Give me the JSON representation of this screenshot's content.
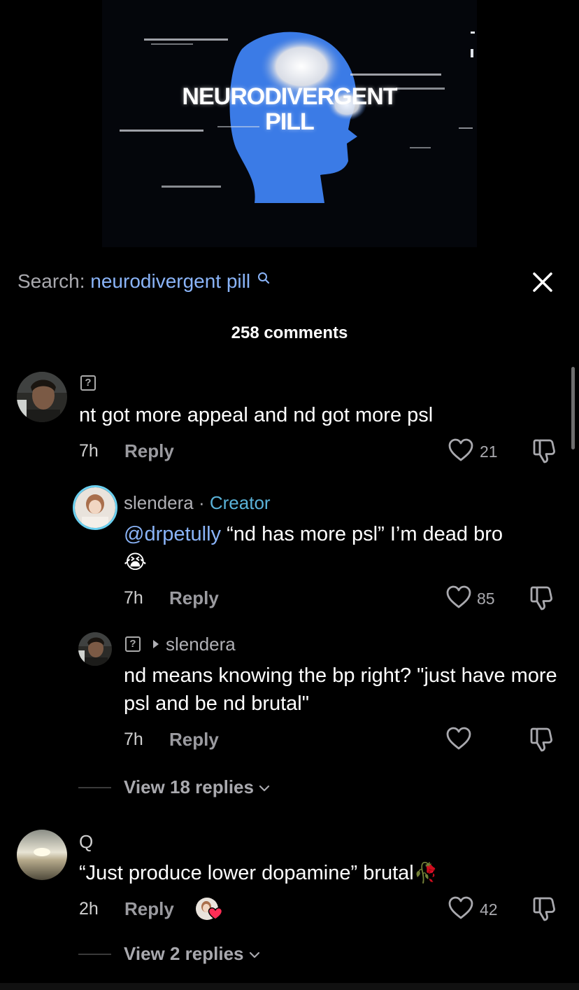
{
  "video": {
    "title": "NEURODIVERGENT\nPILL"
  },
  "search": {
    "label": "Search:",
    "term": "neurodivergent pill"
  },
  "comments_header": {
    "count_text": "258 comments"
  },
  "colors": {
    "background": "#000000",
    "search_term": "#8ab4f8",
    "creator": "#5ab2d8",
    "muted": "#a9a9ae",
    "like_heart_red": "#ff2d55"
  },
  "comments": [
    {
      "username_badge": "?",
      "text": "nt got more appeal and nd got more psl",
      "time": "7h",
      "reply_label": "Reply",
      "likes": "21",
      "replies": [
        {
          "username": "slendera",
          "separator": "·",
          "role": "Creator",
          "mention": "@drpetully",
          "text": " “nd has more psl” I’m dead bro",
          "emoji": "😭",
          "time": "7h",
          "reply_label": "Reply",
          "likes": "85"
        },
        {
          "username_badge": "?",
          "reply_to": "slendera",
          "text": "nd means knowing the bp right? \"just have more psl and be nd brutal\"",
          "time": "7h",
          "reply_label": "Reply",
          "likes": ""
        }
      ],
      "view_replies": "View 18 replies"
    },
    {
      "username": "Q",
      "text": "“Just produce lower dopamine” brutal",
      "emoji": "🥀",
      "time": "2h",
      "reply_label": "Reply",
      "likes": "42",
      "view_replies": "View 2 replies"
    }
  ],
  "icons": [
    "search-icon",
    "close-icon",
    "heart-icon",
    "dislike-icon",
    "play-triangle-icon",
    "chevron-down-icon"
  ]
}
